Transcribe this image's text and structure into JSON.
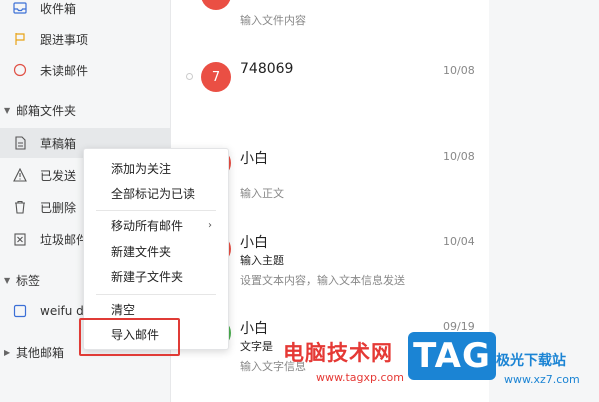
{
  "sidebar": {
    "items_top": [
      {
        "label": "收件箱",
        "icon": "inbox-icon"
      },
      {
        "label": "跟进事项",
        "icon": "flag-icon"
      },
      {
        "label": "未读邮件",
        "icon": "circle-icon"
      }
    ],
    "section_folders": "邮箱文件夹",
    "folders": [
      {
        "label": "草稿箱",
        "icon": "draft-icon"
      },
      {
        "label": "已发送",
        "icon": "sent-icon"
      },
      {
        "label": "已删除",
        "icon": "trash-icon"
      },
      {
        "label": "垃圾邮件",
        "icon": "spam-icon"
      }
    ],
    "section_tags": "标签",
    "tag_item": "weifu d",
    "section_other": "其他邮箱"
  },
  "mails": [
    {
      "avatar_text": "",
      "avatar_color": "#ea4f44",
      "title": "",
      "date": "",
      "subject": "",
      "preview": "输入文件内容"
    },
    {
      "avatar_text": "7",
      "avatar_color": "#ea4f44",
      "title": "748069",
      "date": "10/08",
      "subject": "",
      "preview": ""
    },
    {
      "avatar_text": "",
      "avatar_color": "#ea4f44",
      "title": "小白",
      "date": "10/08",
      "subject": "",
      "preview": "输入正文"
    },
    {
      "avatar_text": "",
      "avatar_color": "#ea4f44",
      "title": "小白",
      "date": "10/04",
      "subject": "输入主题",
      "preview": "设置文本内容，输入文本信息发送"
    },
    {
      "avatar_text": "",
      "avatar_color": "#4caf50",
      "title": "小白",
      "date": "09/19",
      "subject": "文字是",
      "preview": "输入文字信息"
    }
  ],
  "context_menu": {
    "items": [
      {
        "label": "添加为关注",
        "has_submenu": false
      },
      {
        "label": "全部标记为已读",
        "has_submenu": false
      },
      {
        "label": "移动所有邮件",
        "has_submenu": true
      },
      {
        "label": "新建文件夹",
        "has_submenu": false
      },
      {
        "label": "新建子文件夹",
        "has_submenu": false
      },
      {
        "label": "清空",
        "has_submenu": false
      },
      {
        "label": "导入邮件",
        "has_submenu": false
      }
    ],
    "highlight_color": "#e03b36"
  },
  "watermark": {
    "text": "电脑技术网",
    "url": "www.tagxp.com",
    "tag": "TAG",
    "site_name": "极光下载站",
    "site_url": "www.xz7.com"
  }
}
